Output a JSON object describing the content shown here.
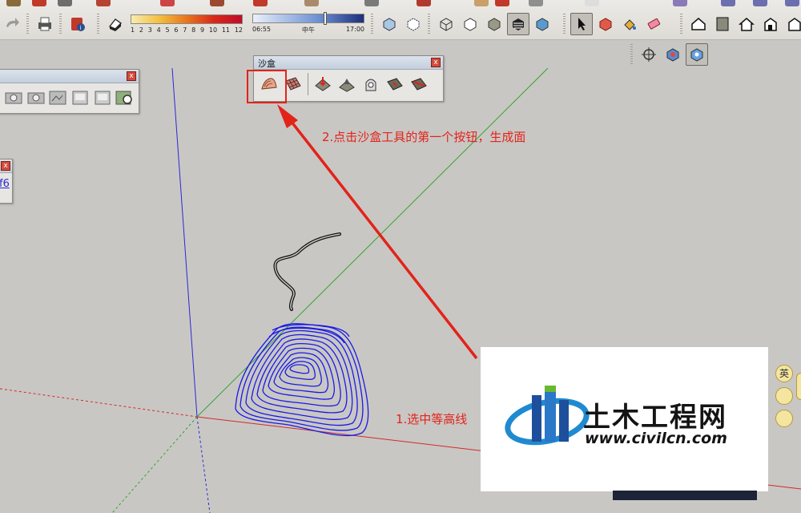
{
  "toolbar": {
    "shadow_ticks": [
      "1",
      "2",
      "3",
      "4",
      "5",
      "6",
      "7",
      "8",
      "9",
      "10",
      "11",
      "12"
    ],
    "time_start": "06:55",
    "time_mid": "中午",
    "time_end": "17:00"
  },
  "sandbox_panel": {
    "title": "沙盒",
    "close": "x"
  },
  "left_panel_small": {
    "close": "x",
    "snippet": "f6"
  },
  "annotations": {
    "step2": "2.点击沙盒工具的第一个按钮，生成面",
    "step1": "1.选中等高线"
  },
  "watermark": {
    "site_name": "土木工程网",
    "url": "www.civilcn.com"
  },
  "ime": {
    "lang": "英"
  },
  "colors": {
    "annotation_red": "#e2231a",
    "contour_blue": "#1a1ae6",
    "axis_green": "#2fa52f",
    "axis_red": "#d12a2a",
    "axis_blue": "#2a2ad1"
  }
}
